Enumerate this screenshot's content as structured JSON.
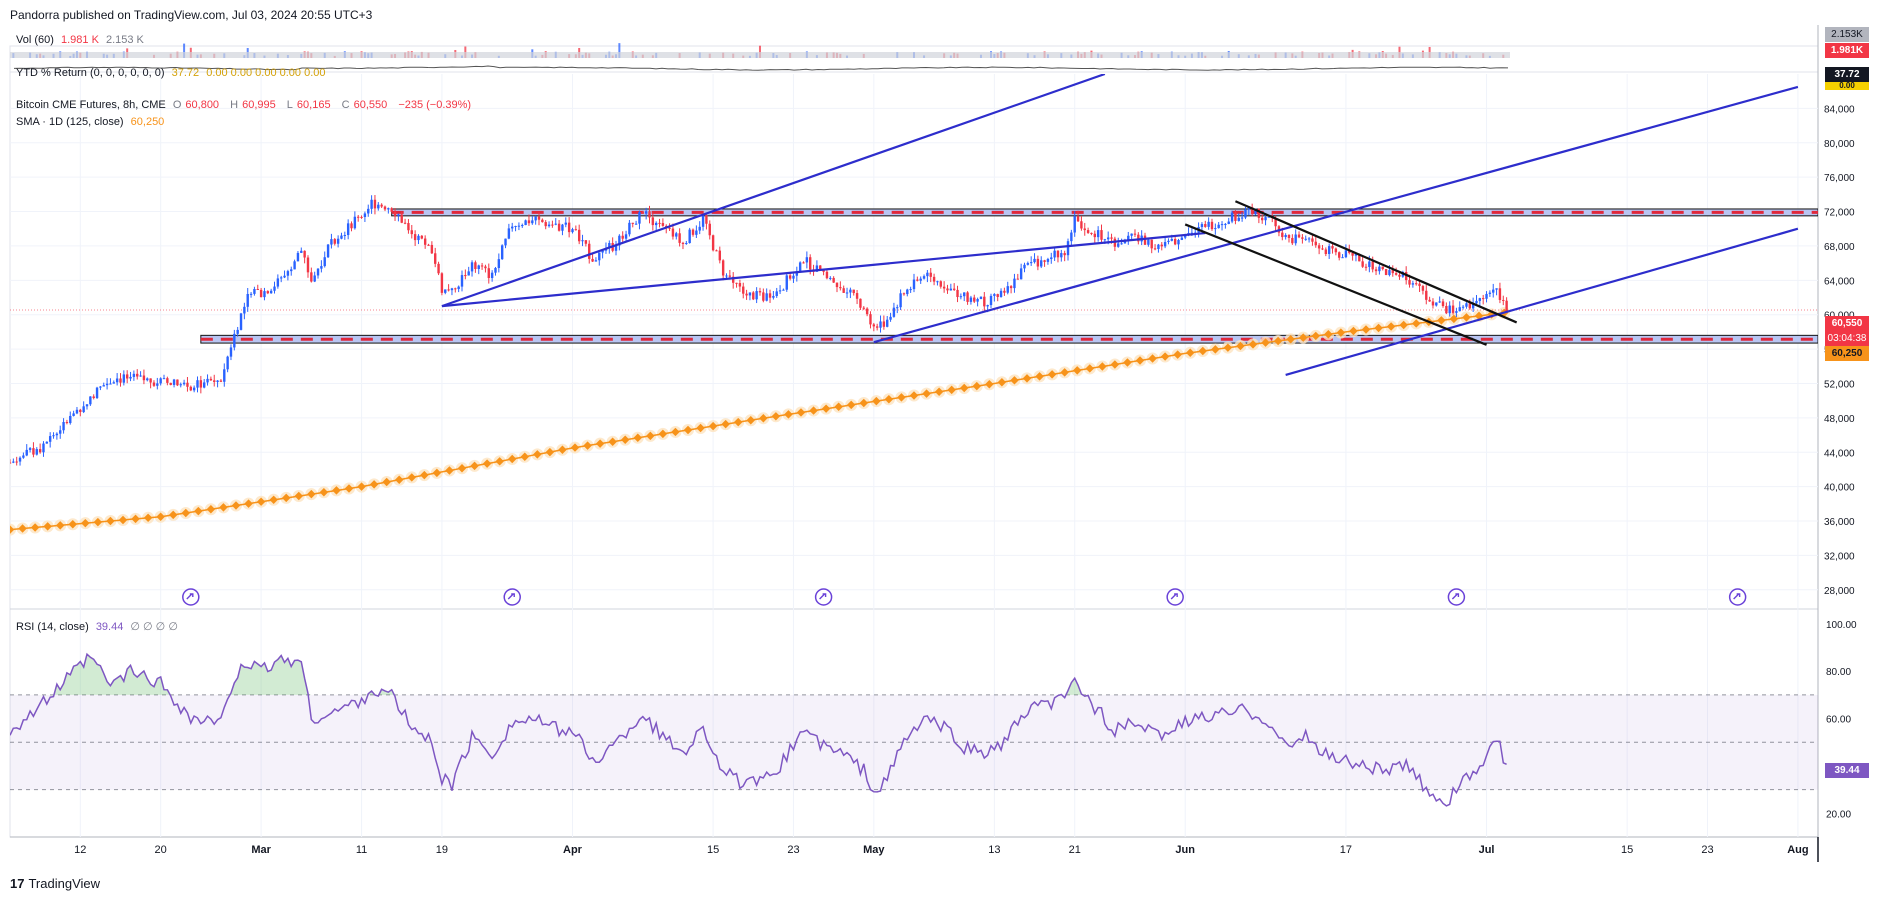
{
  "header": {
    "publisher_text": "Pandorra published on TradingView.com, Jul 03, 2024 20:55 UTC+3"
  },
  "footer": {
    "logo": "17",
    "brand": "TradingView"
  },
  "indicators": {
    "vol": {
      "label": "Vol (60)",
      "value1": "1.981 K",
      "value2": "2.153 K",
      "axis_top": "2.153K",
      "axis_bottom": "1.981K"
    },
    "ytd": {
      "label": "YTD % Return (0, 0, 0, 0, 0, 0)",
      "value": "37.72",
      "zeros": "0.00  0.00  0.00  0.00  0.00",
      "axis_value": "37.72",
      "axis_zero": "0.00"
    },
    "rsi": {
      "label": "RSI (14, close)",
      "value": "39.44",
      "extras": "∅ ∅ ∅ ∅",
      "axis_value": "39.44"
    }
  },
  "main_legend": {
    "symbol": "Bitcoin CME Futures, 8h, CME",
    "open_label": "O",
    "open": "60,800",
    "high_label": "H",
    "high": "60,995",
    "low_label": "L",
    "low": "60,165",
    "close_label": "C",
    "close": "60,550",
    "change": "−235 (−0.39%)",
    "sma_label": "SMA · 1D (125, close)",
    "sma_value": "60,250"
  },
  "price_tags": {
    "last": "60,550",
    "countdown": "03:04:38",
    "sma": "60,250"
  },
  "colors": {
    "up": "#2962ff",
    "down": "#f23645",
    "trendline": "#2d2dcc",
    "channel": "#111111",
    "sma": "#f7931a",
    "rsi": "#7e57c2",
    "band": "#b9c5f2",
    "band_dash": "#e0283c"
  },
  "chart_data": {
    "type": "candlestick",
    "title": "Bitcoin CME Futures, 8h, CME",
    "y_axis": {
      "ticks": [
        28000,
        32000,
        36000,
        40000,
        44000,
        48000,
        52000,
        56000,
        60000,
        64000,
        68000,
        72000,
        76000,
        80000,
        84000
      ],
      "tick_labels": [
        "28,000",
        "32,000",
        "36,000",
        "40,000",
        "44,000",
        "48,000",
        "52,000",
        "56,000",
        "60,000",
        "64,000",
        "68,000",
        "72,000",
        "76,000",
        "80,000",
        "84,000"
      ],
      "ylim": [
        26000,
        88000
      ]
    },
    "x_axis": {
      "tick_labels": [
        "12",
        "20",
        "Mar",
        "11",
        "19",
        "Apr",
        "15",
        "23",
        "May",
        "13",
        "21",
        "Jun",
        "17",
        "Jul",
        "15",
        "23",
        "Aug"
      ],
      "tick_dates": [
        "2024-02-12",
        "2024-02-20",
        "2024-03-01",
        "2024-03-11",
        "2024-03-19",
        "2024-04-01",
        "2024-04-15",
        "2024-04-23",
        "2024-05-01",
        "2024-05-13",
        "2024-05-21",
        "2024-06-01",
        "2024-06-17",
        "2024-07-01",
        "2024-07-15",
        "2024-07-23",
        "2024-08-01"
      ],
      "xlim": [
        "2024-02-05",
        "2024-08-03"
      ]
    },
    "price_path": [
      [
        "2024-02-05",
        42800
      ],
      [
        "2024-02-08",
        44500
      ],
      [
        "2024-02-11",
        48000
      ],
      [
        "2024-02-13",
        50500
      ],
      [
        "2024-02-15",
        52500
      ],
      [
        "2024-02-17",
        52600
      ],
      [
        "2024-02-20",
        52200
      ],
      [
        "2024-02-23",
        51700
      ],
      [
        "2024-02-26",
        52500
      ],
      [
        "2024-02-27",
        56500
      ],
      [
        "2024-02-28",
        60000
      ],
      [
        "2024-02-29",
        63000
      ],
      [
        "2024-03-01",
        62500
      ],
      [
        "2024-03-03",
        64000
      ],
      [
        "2024-03-05",
        67500
      ],
      [
        "2024-03-06",
        64000
      ],
      [
        "2024-03-08",
        68500
      ],
      [
        "2024-03-11",
        71500
      ],
      [
        "2024-03-12",
        73000
      ],
      [
        "2024-03-14",
        72500
      ],
      [
        "2024-03-16",
        69500
      ],
      [
        "2024-03-18",
        67500
      ],
      [
        "2024-03-19",
        63000
      ],
      [
        "2024-03-20",
        62500
      ],
      [
        "2024-03-22",
        66000
      ],
      [
        "2024-03-24",
        64500
      ],
      [
        "2024-03-26",
        70500
      ],
      [
        "2024-03-28",
        71000
      ],
      [
        "2024-03-30",
        70500
      ],
      [
        "2024-04-01",
        70000
      ],
      [
        "2024-04-03",
        66500
      ],
      [
        "2024-04-05",
        68000
      ],
      [
        "2024-04-08",
        72000
      ],
      [
        "2024-04-10",
        70000
      ],
      [
        "2024-04-12",
        68500
      ],
      [
        "2024-04-14",
        71000
      ],
      [
        "2024-04-16",
        65000
      ],
      [
        "2024-04-18",
        62500
      ],
      [
        "2024-04-20",
        62000
      ],
      [
        "2024-04-22",
        63500
      ],
      [
        "2024-04-24",
        66500
      ],
      [
        "2024-04-26",
        64500
      ],
      [
        "2024-04-28",
        63000
      ],
      [
        "2024-04-30",
        61000
      ],
      [
        "2024-05-01",
        58500
      ],
      [
        "2024-05-02",
        59000
      ],
      [
        "2024-05-04",
        62500
      ],
      [
        "2024-05-06",
        64500
      ],
      [
        "2024-05-08",
        63500
      ],
      [
        "2024-05-10",
        62000
      ],
      [
        "2024-05-12",
        61500
      ],
      [
        "2024-05-14",
        62500
      ],
      [
        "2024-05-16",
        65500
      ],
      [
        "2024-05-18",
        66500
      ],
      [
        "2024-05-20",
        67500
      ],
      [
        "2024-05-21",
        71000
      ],
      [
        "2024-05-23",
        69500
      ],
      [
        "2024-05-25",
        68500
      ],
      [
        "2024-05-27",
        69000
      ],
      [
        "2024-05-29",
        68000
      ],
      [
        "2024-05-31",
        68500
      ],
      [
        "2024-06-02",
        70000
      ],
      [
        "2024-06-05",
        71000
      ],
      [
        "2024-06-07",
        72000
      ],
      [
        "2024-06-09",
        71500
      ],
      [
        "2024-06-11",
        69000
      ],
      [
        "2024-06-13",
        68500
      ],
      [
        "2024-06-15",
        67500
      ],
      [
        "2024-06-17",
        67000
      ],
      [
        "2024-06-19",
        66000
      ],
      [
        "2024-06-21",
        65000
      ],
      [
        "2024-06-23",
        64500
      ],
      [
        "2024-06-25",
        62000
      ],
      [
        "2024-06-27",
        60500
      ],
      [
        "2024-06-29",
        61000
      ],
      [
        "2024-07-01",
        62000
      ],
      [
        "2024-07-02",
        63000
      ],
      [
        "2024-07-03",
        60550
      ]
    ],
    "sma_path": [
      [
        "2024-02-05",
        35000
      ],
      [
        "2024-02-20",
        36500
      ],
      [
        "2024-03-11",
        40000
      ],
      [
        "2024-04-01",
        44500
      ],
      [
        "2024-04-23",
        48500
      ],
      [
        "2024-05-13",
        52000
      ],
      [
        "2024-06-01",
        55500
      ],
      [
        "2024-06-17",
        58000
      ],
      [
        "2024-07-03",
        60250
      ]
    ],
    "range_bands": [
      {
        "top": 72300,
        "bottom": 71500
      },
      {
        "top": 57600,
        "bottom": 56700
      }
    ],
    "trendlines": [
      {
        "from": [
          "2024-03-19",
          61000
        ],
        "to": [
          "2024-05-24",
          88000
        ],
        "color": "trendline"
      },
      {
        "from": [
          "2024-03-19",
          61000
        ],
        "to": [
          "2024-06-03",
          69500
        ],
        "color": "trendline"
      },
      {
        "from": [
          "2024-05-01",
          56800
        ],
        "to": [
          "2024-08-01",
          86500
        ],
        "color": "trendline"
      },
      {
        "from": [
          "2024-06-11",
          53000
        ],
        "to": [
          "2024-08-01",
          70000
        ],
        "color": "trendline"
      },
      {
        "from": [
          "2024-06-06",
          73200
        ],
        "to": [
          "2024-07-04",
          59100
        ],
        "color": "channel"
      },
      {
        "from": [
          "2024-06-01",
          70500
        ],
        "to": [
          "2024-07-01",
          56500
        ],
        "color": "channel"
      }
    ],
    "rsi": {
      "ylim": [
        10,
        105
      ],
      "ticks": [
        20,
        40,
        60,
        80,
        100
      ],
      "tick_labels": [
        "20.00",
        "40.00",
        "60.00",
        "80.00",
        "100.00"
      ],
      "bands": [
        30,
        50,
        70
      ],
      "path": [
        [
          "2024-02-05",
          55
        ],
        [
          "2024-02-08",
          65
        ],
        [
          "2024-02-11",
          78
        ],
        [
          "2024-02-13",
          86
        ],
        [
          "2024-02-15",
          74
        ],
        [
          "2024-02-17",
          80
        ],
        [
          "2024-02-20",
          75
        ],
        [
          "2024-02-23",
          60
        ],
        [
          "2024-02-26",
          58
        ],
        [
          "2024-02-27",
          72
        ],
        [
          "2024-02-28",
          84
        ],
        [
          "2024-03-01",
          80
        ],
        [
          "2024-03-03",
          85
        ],
        [
          "2024-03-05",
          84
        ],
        [
          "2024-03-06",
          60
        ],
        [
          "2024-03-08",
          62
        ],
        [
          "2024-03-11",
          68
        ],
        [
          "2024-03-12",
          72
        ],
        [
          "2024-03-14",
          70
        ],
        [
          "2024-03-16",
          56
        ],
        [
          "2024-03-18",
          50
        ],
        [
          "2024-03-19",
          35
        ],
        [
          "2024-03-20",
          32
        ],
        [
          "2024-03-22",
          52
        ],
        [
          "2024-03-24",
          45
        ],
        [
          "2024-03-26",
          58
        ],
        [
          "2024-03-28",
          60
        ],
        [
          "2024-03-30",
          56
        ],
        [
          "2024-04-01",
          55
        ],
        [
          "2024-04-03",
          42
        ],
        [
          "2024-04-05",
          48
        ],
        [
          "2024-04-08",
          62
        ],
        [
          "2024-04-10",
          52
        ],
        [
          "2024-04-12",
          46
        ],
        [
          "2024-04-14",
          56
        ],
        [
          "2024-04-16",
          38
        ],
        [
          "2024-04-18",
          32
        ],
        [
          "2024-04-20",
          33
        ],
        [
          "2024-04-22",
          42
        ],
        [
          "2024-04-24",
          56
        ],
        [
          "2024-04-26",
          48
        ],
        [
          "2024-04-28",
          45
        ],
        [
          "2024-04-30",
          38
        ],
        [
          "2024-05-01",
          30
        ],
        [
          "2024-05-02",
          32
        ],
        [
          "2024-05-04",
          50
        ],
        [
          "2024-05-06",
          60
        ],
        [
          "2024-05-08",
          56
        ],
        [
          "2024-05-10",
          48
        ],
        [
          "2024-05-12",
          45
        ],
        [
          "2024-05-14",
          50
        ],
        [
          "2024-05-16",
          62
        ],
        [
          "2024-05-18",
          66
        ],
        [
          "2024-05-20",
          68
        ],
        [
          "2024-05-21",
          76
        ],
        [
          "2024-05-23",
          65
        ],
        [
          "2024-05-25",
          55
        ],
        [
          "2024-05-27",
          58
        ],
        [
          "2024-05-29",
          53
        ],
        [
          "2024-05-31",
          56
        ],
        [
          "2024-06-02",
          60
        ],
        [
          "2024-06-05",
          62
        ],
        [
          "2024-06-07",
          64
        ],
        [
          "2024-06-09",
          60
        ],
        [
          "2024-06-11",
          48
        ],
        [
          "2024-06-13",
          52
        ],
        [
          "2024-06-15",
          45
        ],
        [
          "2024-06-17",
          42
        ],
        [
          "2024-06-19",
          40
        ],
        [
          "2024-06-21",
          38
        ],
        [
          "2024-06-23",
          40
        ],
        [
          "2024-06-25",
          30
        ],
        [
          "2024-06-27",
          25
        ],
        [
          "2024-06-29",
          35
        ],
        [
          "2024-07-01",
          42
        ],
        [
          "2024-07-02",
          52
        ],
        [
          "2024-07-03",
          39.44
        ]
      ]
    },
    "event_markers": [
      "2024-02-23",
      "2024-03-26",
      "2024-04-26",
      "2024-05-31",
      "2024-06-28",
      "2024-07-26"
    ]
  }
}
